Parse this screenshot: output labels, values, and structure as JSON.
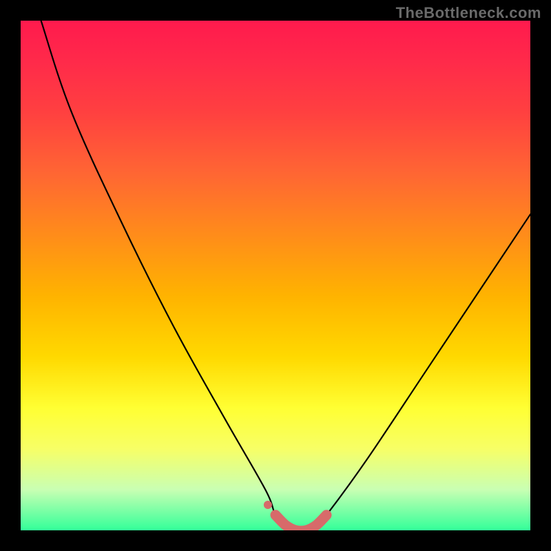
{
  "watermark": "TheBottleneck.com",
  "chart_data": {
    "type": "line",
    "title": "",
    "xlabel": "",
    "ylabel": "",
    "xlim": [
      0,
      100
    ],
    "ylim": [
      0,
      100
    ],
    "grid": false,
    "series": [
      {
        "name": "bottleneck-curve",
        "x": [
          4,
          10,
          20,
          30,
          40,
          48,
          50,
          52,
          54,
          56,
          58,
          60,
          68,
          80,
          92,
          100
        ],
        "y": [
          100,
          82,
          60,
          40,
          22,
          8,
          3,
          1,
          0,
          0,
          1,
          3,
          14,
          32,
          50,
          62
        ],
        "color": "#000000"
      },
      {
        "name": "highlight-band",
        "x": [
          50,
          52,
          54,
          56,
          58,
          60
        ],
        "y": [
          3,
          1,
          0,
          0,
          1,
          3
        ],
        "color": "#d76a6a"
      }
    ],
    "gradient_stops": [
      {
        "pos": 0,
        "color": "#ff1a4d"
      },
      {
        "pos": 18,
        "color": "#ff4040"
      },
      {
        "pos": 42,
        "color": "#ff8c1a"
      },
      {
        "pos": 66,
        "color": "#ffd900"
      },
      {
        "pos": 84,
        "color": "#f7ff66"
      },
      {
        "pos": 100,
        "color": "#33ff99"
      }
    ]
  }
}
